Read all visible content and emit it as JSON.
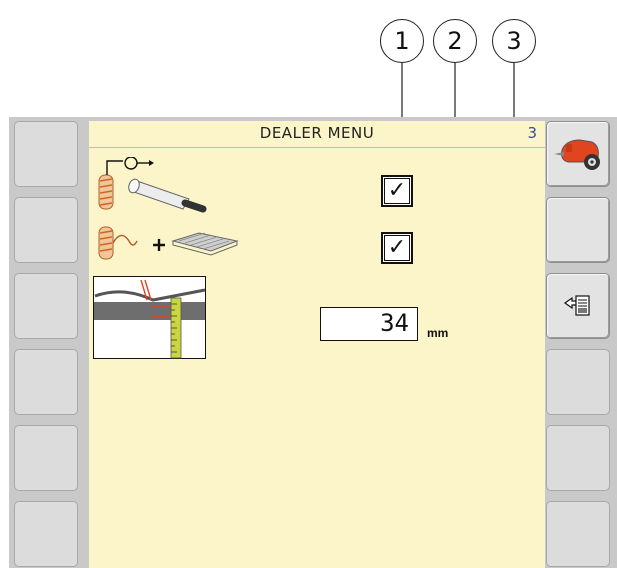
{
  "callouts": [
    "1",
    "2",
    "3"
  ],
  "screen": {
    "title": "DEALER MENU",
    "page_number": "3",
    "background_color": "#fbf5c9"
  },
  "settings": [
    {
      "icon": "twine-net-wrap-roll-icon",
      "control": "checkbox",
      "checked": true,
      "check_glyph": "✓"
    },
    {
      "icon": "twine-plus-net-icon",
      "control": "checkbox",
      "checked": true,
      "check_glyph": "✓"
    },
    {
      "icon": "twine-arm-offset-gauge-icon",
      "control": "numeric-field",
      "value": "34",
      "unit": "mm"
    }
  ],
  "softkeys": {
    "left": [
      "",
      "",
      "",
      "",
      "",
      ""
    ],
    "right": [
      {
        "icon": "round-baler-icon"
      },
      {
        "icon": ""
      },
      {
        "icon": "back-to-list-icon",
        "glyph": "◁"
      },
      {
        "icon": ""
      },
      {
        "icon": ""
      },
      {
        "icon": ""
      }
    ]
  },
  "colors": {
    "screen_bg": "#fbf5c9",
    "bezel": "#c9c9c9",
    "softkey": "#dcdcdc",
    "page_number": "#3a4aa0",
    "baler_red": "#e0451f"
  }
}
